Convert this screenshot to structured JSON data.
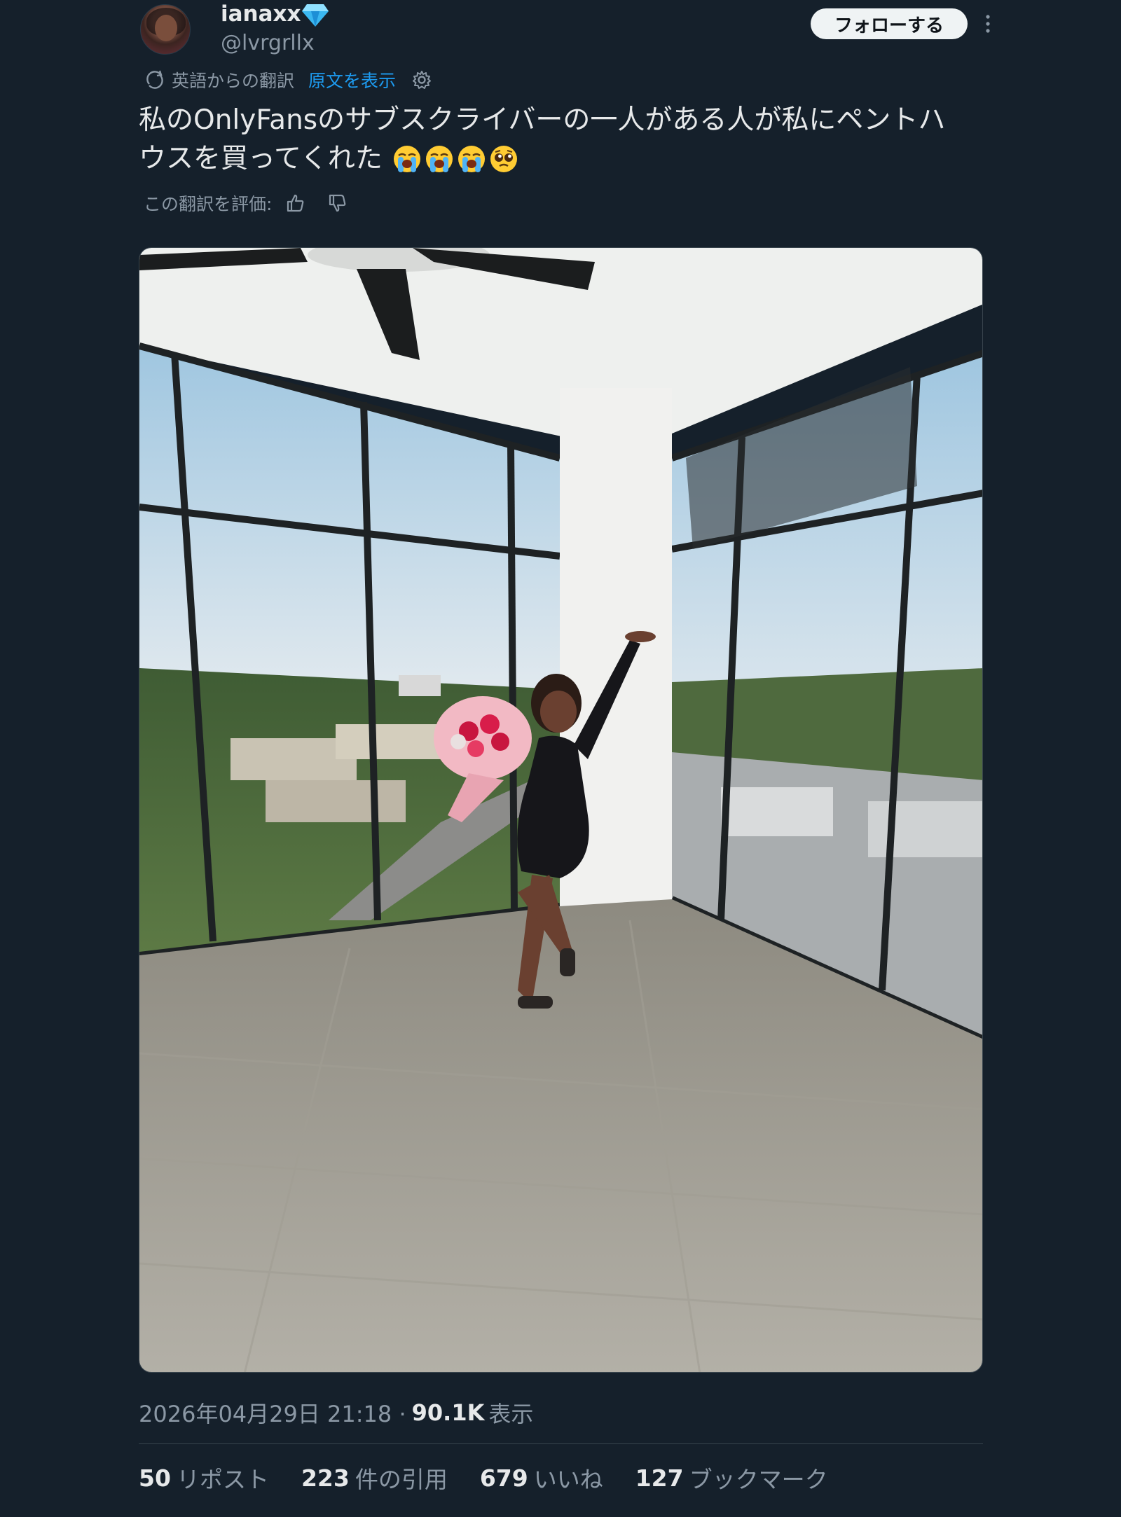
{
  "author": {
    "display_name": "ianaxx",
    "handle": "@lvrgrllx",
    "verified_icon": "diamond-icon"
  },
  "actions": {
    "follow_label": "フォローする",
    "more_icon": "more-options-icon"
  },
  "translation": {
    "label": "英語からの翻訳",
    "show_original": "原文を表示",
    "rate_label": "この翻訳を評価:"
  },
  "tweet": {
    "text_line1": "私のOnlyFansのサブスクライバーの一人がある人が私にペントハ",
    "text_line2": "ウスを買ってくれた",
    "emojis": [
      "loudly-crying-face",
      "loudly-crying-face",
      "loudly-crying-face",
      "pleading-face"
    ]
  },
  "meta": {
    "timestamp": "2026年04月29日 21:18 ·",
    "views_count": "90.1K",
    "views_label": "表示"
  },
  "stats": [
    {
      "count": "50",
      "label": "リポスト"
    },
    {
      "count": "223",
      "label": "件の引用"
    },
    {
      "count": "679",
      "label": "いいね"
    },
    {
      "count": "127",
      "label": "ブックマーク"
    }
  ],
  "colors": {
    "background": "#15202b",
    "accent": "#1d9bf0",
    "muted": "#8b98a5"
  }
}
